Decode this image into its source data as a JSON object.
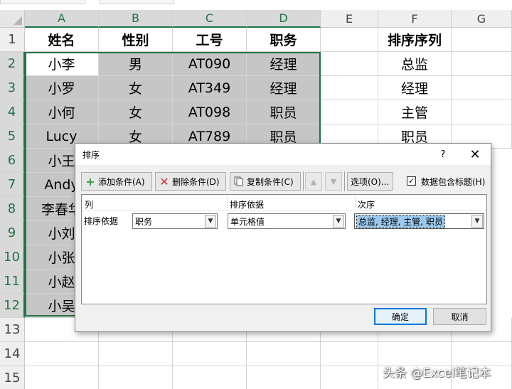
{
  "sheet": {
    "columns": [
      "A",
      "B",
      "C",
      "D",
      "E",
      "F",
      "G"
    ],
    "row_numbers": [
      "1",
      "2",
      "3",
      "4",
      "5",
      "6",
      "7",
      "8",
      "9",
      "10",
      "11",
      "12",
      "13",
      "14",
      "15"
    ],
    "headers": {
      "a": "姓名",
      "b": "性别",
      "c": "工号",
      "d": "职务",
      "f": "排序序列"
    },
    "rows": [
      {
        "a": "小李",
        "b": "男",
        "c": "AT090",
        "d": "经理",
        "f": "总监"
      },
      {
        "a": "小罗",
        "b": "女",
        "c": "AT349",
        "d": "经理",
        "f": "经理"
      },
      {
        "a": "小何",
        "b": "女",
        "c": "AT098",
        "d": "职员",
        "f": "主管"
      },
      {
        "a": "Lucy",
        "b": "女",
        "c": "AT789",
        "d": "职员",
        "f": "职员"
      },
      {
        "a": "小王",
        "b": "",
        "c": "",
        "d": "",
        "f": ""
      },
      {
        "a": "Andy",
        "b": "",
        "c": "",
        "d": "",
        "f": ""
      },
      {
        "a": "李春华",
        "b": "",
        "c": "",
        "d": "",
        "f": ""
      },
      {
        "a": "小刘",
        "b": "",
        "c": "",
        "d": "",
        "f": ""
      },
      {
        "a": "小张",
        "b": "",
        "c": "",
        "d": "",
        "f": ""
      },
      {
        "a": "小赵",
        "b": "",
        "c": "",
        "d": "",
        "f": ""
      },
      {
        "a": "小吴",
        "b": "",
        "c": "",
        "d": "",
        "f": ""
      }
    ]
  },
  "dialog": {
    "title": "排序",
    "help": "?",
    "close": "✕",
    "toolbar": {
      "add_label": "添加条件(A)",
      "delete_label": "删除条件(D)",
      "copy_label": "复制条件(C)",
      "up_arrow": "▲",
      "down_arrow": "▼",
      "options_label": "选项(O)...",
      "header_checkbox_label": "数据包含标题(H)",
      "header_checkbox_checked": true,
      "add_icon": "plus-icon",
      "delete_icon": "x-icon",
      "copy_icon": "copy-icon"
    },
    "grid": {
      "col_header": "列",
      "basis_header": "排序依据",
      "order_header": "次序",
      "row_label": "排序依据",
      "column_value": "职务",
      "basis_value": "单元格值",
      "order_value": "总监, 经理, 主管, 职员"
    },
    "ok_label": "确定",
    "cancel_label": "取消"
  },
  "watermark": "头条 @Excel笔记本",
  "colors": {
    "selection": "#217346",
    "highlight": "#c6c6c6",
    "ok_border": "#0078d7",
    "order_highlight": "#99c9ef"
  }
}
